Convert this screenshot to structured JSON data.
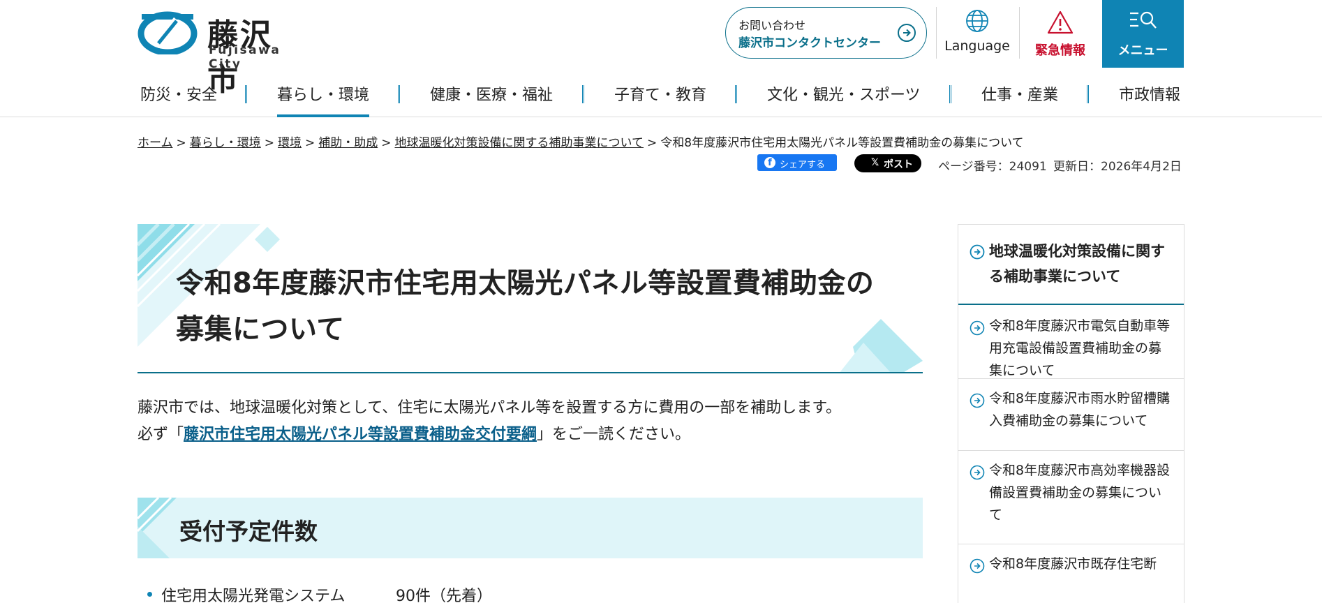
{
  "header": {
    "logo_text": "藤沢市",
    "logo_sub": "Fujisawa City",
    "contact_line1": "お問い合わせ",
    "contact_line2": "藤沢市コンタクトセンター",
    "language_label": "Language",
    "emergency_label": "緊急情報",
    "menu_label": "メニュー",
    "icons": [
      "city-emblem-icon",
      "arrow-circle-right-icon",
      "globe-icon",
      "warning-icon",
      "search-menu-icon"
    ]
  },
  "nav": {
    "items": [
      {
        "label": "防災・安全"
      },
      {
        "label": "暮らし・環境"
      },
      {
        "label": "健康・医療・福祉"
      },
      {
        "label": "子育て・教育"
      },
      {
        "label": "文化・観光・スポーツ"
      },
      {
        "label": "仕事・産業"
      },
      {
        "label": "市政情報"
      }
    ],
    "active_index": 1
  },
  "breadcrumb": {
    "items": [
      "ホーム",
      "暮らし・環境",
      "環境",
      "補助・助成",
      "地球温暖化対策設備に関する補助事業について"
    ],
    "current": "令和8年度藤沢市住宅用太陽光パネル等設置費補助金の募集について",
    "separator": ">"
  },
  "meta": {
    "share_label": "シェアする",
    "post_label": "ポスト",
    "page_number": "ページ番号：24091",
    "updated": "更新日：2026年4月2日"
  },
  "main": {
    "title": "令和8年度藤沢市住宅用太陽光パネル等設置費補助金の募集について",
    "intro_line1": "藤沢市では、地球温暖化対策として、住宅に太陽光パネル等を設置する方に費用の一部を補助します。",
    "intro_pre": "必ず「",
    "intro_link": "藤沢市住宅用太陽光パネル等設置費補助金交付要綱",
    "intro_post": "」をご一読ください。",
    "section_title": "受付予定件数",
    "list": [
      {
        "label": "住宅用太陽光発電システム",
        "value": "90件（先着）"
      }
    ]
  },
  "sidebar": {
    "heading": "地球温暖化対策設備に関する補助事業について",
    "items": [
      "令和8年度藤沢市電気自動車等用充電設備設置費補助金の募集について",
      "令和8年度藤沢市雨水貯留槽購入費補助金の募集について",
      "令和8年度藤沢市高効率機器設備設置費補助金の募集について",
      "令和8年度藤沢市既存住宅断"
    ]
  },
  "colors": {
    "accent": "#0f84b4",
    "accent_dark": "#0a6f8a",
    "emergency": "#c8102e",
    "section_bg": "#dff5f9"
  }
}
